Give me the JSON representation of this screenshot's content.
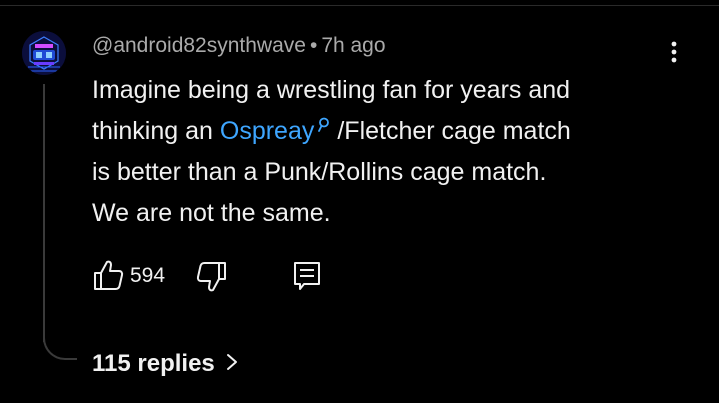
{
  "comment": {
    "author": "@android82synthwave",
    "separator": "•",
    "time": "7h ago",
    "text_line1": "Imagine being a wrestling fan for years and",
    "text_line2_before": "thinking an ",
    "text_link": "Ospreay",
    "text_line2_after": "/Fletcher cage match",
    "text_line3": "is better than a Punk/Rollins cage match.",
    "text_line4": "We are not the same."
  },
  "actions": {
    "like_count": "594",
    "like_icon": "thumbs-up-icon",
    "dislike_icon": "thumbs-down-icon",
    "reply_icon": "reply-icon"
  },
  "replies": {
    "label": "115 replies",
    "icon": "chevron-right-icon"
  },
  "menu": {
    "icon": "more-vertical-icon"
  },
  "colors": {
    "background": "#000000",
    "text": "#f1f1f1",
    "meta": "#aaaaaa",
    "link": "#3ea6ff",
    "thread_line": "#3a3a3a"
  }
}
